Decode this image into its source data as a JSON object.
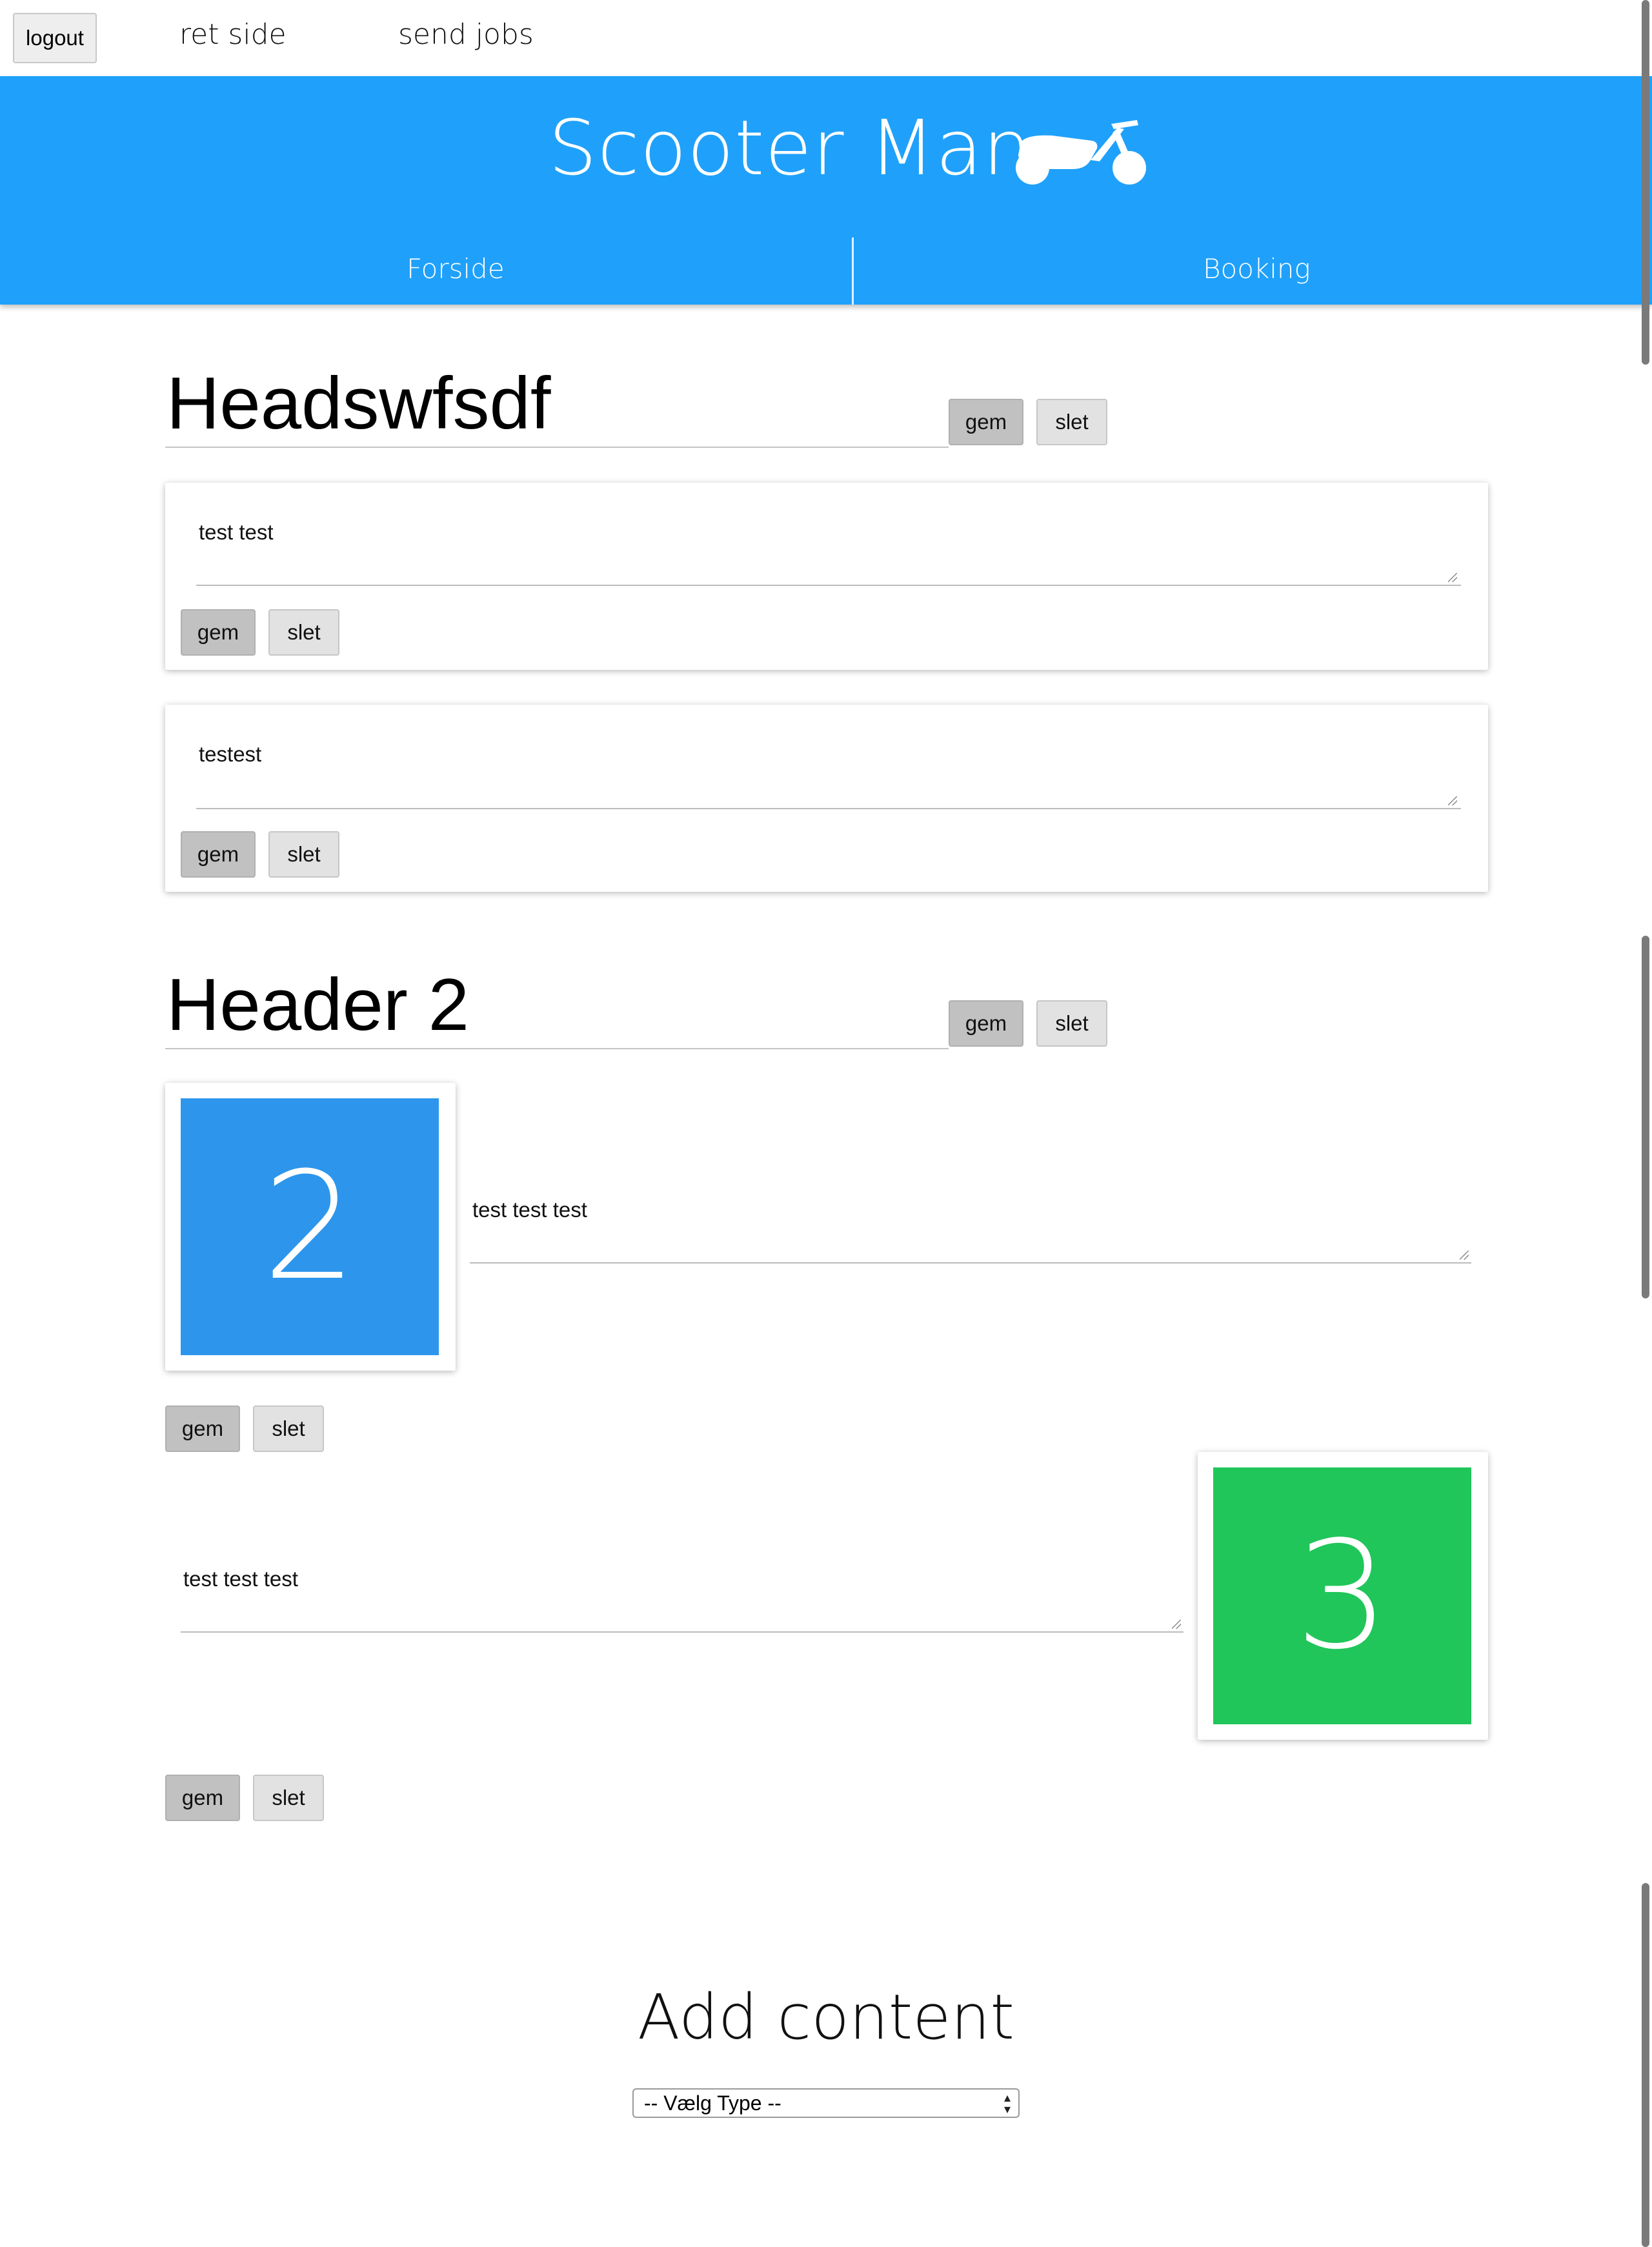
{
  "topbar": {
    "logout_label": "logout",
    "links": [
      "ret side",
      "send jobs"
    ]
  },
  "header": {
    "brand": "Scooter Man",
    "logo_icon": "scooter-icon",
    "nav": [
      "Forside",
      "Booking"
    ],
    "color": "#1fa1fb"
  },
  "sections": [
    {
      "title": "Headswfsdf",
      "gem_label": "gem",
      "slet_label": "slet",
      "blocks": [
        {
          "text": "test test",
          "gem_label": "gem",
          "slet_label": "slet"
        },
        {
          "text": "testest",
          "gem_label": "gem",
          "slet_label": "slet"
        }
      ]
    },
    {
      "title": "Header 2",
      "gem_label": "gem",
      "slet_label": "slet",
      "blocks": [
        {
          "image_number": "2",
          "image_color": "#2d96ec",
          "text": "test test test",
          "gem_label": "gem",
          "slet_label": "slet"
        },
        {
          "image_number": "3",
          "image_color": "#20c65a",
          "text": "test test test",
          "gem_label": "gem",
          "slet_label": "slet"
        }
      ]
    }
  ],
  "add_content": {
    "title": "Add content",
    "select_value": "-- Vælg Type --"
  }
}
